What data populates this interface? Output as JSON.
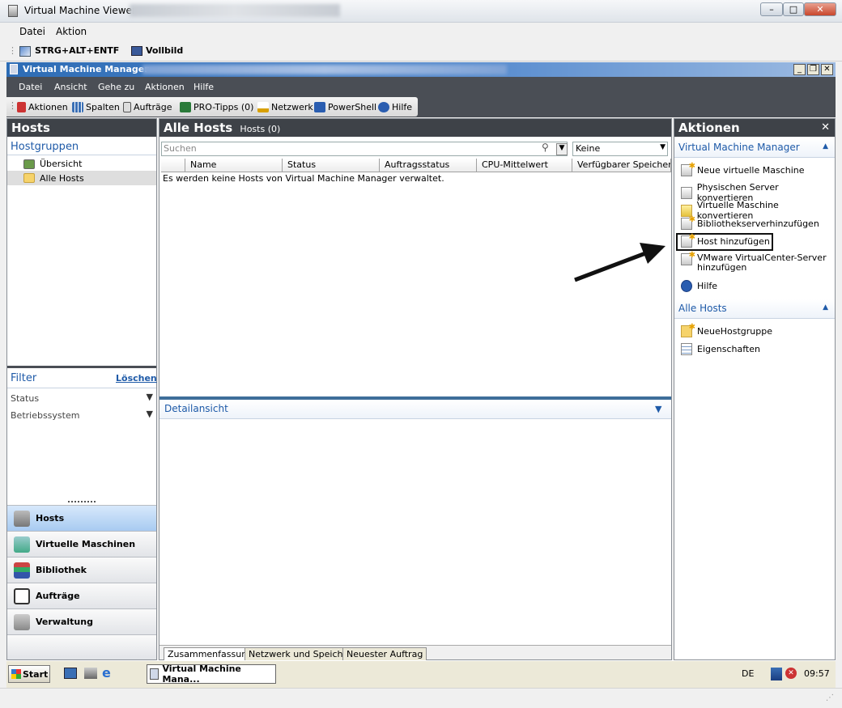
{
  "outer": {
    "title": "Virtual Machine Viewer -",
    "menu": [
      "Datei",
      "Aktion"
    ],
    "toolbar": {
      "ctrl_alt_del": "STRG+ALT+ENTF",
      "fullscreen": "Vollbild"
    }
  },
  "inner": {
    "title": "Virtual Machine Manager -",
    "menu": [
      "Datei",
      "Ansicht",
      "Gehe zu",
      "Aktionen",
      "Hilfe"
    ],
    "toolbar": [
      "Aktionen",
      "Spalten",
      "Aufträge",
      "PRO-Tipps (0)",
      "Netzwerk",
      "PowerShell",
      "Hilfe"
    ]
  },
  "left": {
    "header": "Hosts",
    "groups_title": "Hostgruppen",
    "tree": [
      {
        "label": "Übersicht"
      },
      {
        "label": "Alle Hosts"
      }
    ],
    "filter_title": "Filter",
    "filter_clear": "Löschen",
    "filters": [
      "Status",
      "Betriebssystem"
    ],
    "nav": [
      "Hosts",
      "Virtuelle Maschinen",
      "Bibliothek",
      "Aufträge",
      "Verwaltung"
    ]
  },
  "center": {
    "header": "Alle Hosts",
    "count": "Hosts (0)",
    "search_placeholder": "Suchen",
    "filter_value": "Keine",
    "columns": [
      "Name",
      "Status",
      "Auftragsstatus",
      "CPU-Mittelwert",
      "Verfügbarer Speicher"
    ],
    "empty_msg": "Es werden keine Hosts von Virtual Machine Manager verwaltet.",
    "details_title": "Detailansicht",
    "tabs": [
      "Zusammenfassung",
      "Netzwerk und Speicher",
      "Neuester Auftrag"
    ]
  },
  "right": {
    "header": "Aktionen",
    "section1": "Virtual Machine Manager",
    "actions1": [
      "Neue virtuelle Maschine",
      "Physischen Server konvertieren",
      "Virtuelle Maschine konvertieren",
      "Bibliothekserverhinzufügen",
      "Host hinzufügen",
      "VMware VirtualCenter-Server hinzufügen",
      "Hilfe"
    ],
    "section2": "Alle Hosts",
    "actions2": [
      "NeueHostgruppe",
      "Eigenschaften"
    ]
  },
  "taskbar": {
    "start": "Start",
    "task": "Virtual Machine Mana...",
    "lang": "DE",
    "clock": "09:57"
  }
}
